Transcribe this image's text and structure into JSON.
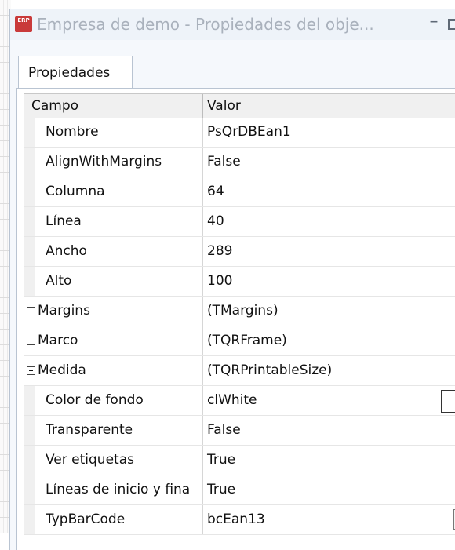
{
  "window": {
    "title": "Empresa de demo - Propiedades del obje...",
    "app_icon_text": "ERP",
    "minimize_glyph": "–"
  },
  "tabs": [
    {
      "label": "Propiedades",
      "active": true
    }
  ],
  "grid": {
    "columns": {
      "campo": "Campo",
      "valor": "Valor"
    },
    "rows": [
      {
        "name": "Nombre",
        "value": "PsQrDBEan1"
      },
      {
        "name": "AlignWithMargins",
        "value": "False"
      },
      {
        "name": "Columna",
        "value": "64"
      },
      {
        "name": "Línea",
        "value": "40"
      },
      {
        "name": "Ancho",
        "value": "289"
      },
      {
        "name": "Alto",
        "value": "100"
      },
      {
        "name": "Margins",
        "value": "(TMargins)",
        "expandable": true
      },
      {
        "name": "Marco",
        "value": "(TQRFrame)",
        "expandable": true
      },
      {
        "name": "Medida",
        "value": "(TQRPrintableSize)",
        "expandable": true
      },
      {
        "name": "Color de fondo",
        "value": "clWhite",
        "color_swatch": "#ffffff"
      },
      {
        "name": "Transparente",
        "value": "False"
      },
      {
        "name": "Ver etiquetas",
        "value": "True"
      },
      {
        "name": "Líneas de inicio y fina",
        "value": "True"
      },
      {
        "name": "TypBarCode",
        "value": "bcEan13",
        "dropdown": true
      }
    ]
  },
  "colors": {
    "app_icon": "#c93a3a",
    "title_text": "#a9b1bc",
    "header_bg": "#f0f0f0"
  }
}
